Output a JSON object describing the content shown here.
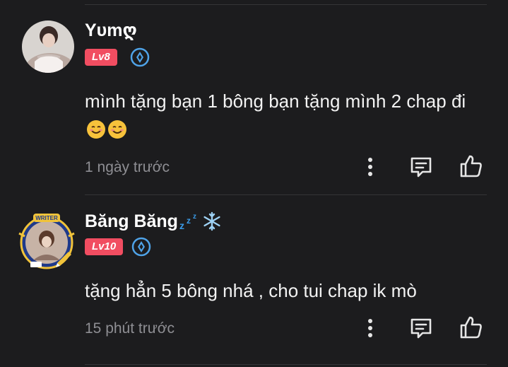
{
  "comments": [
    {
      "username": "Yυmღ",
      "level": "Lv8",
      "text": "mình tặng bạn 1 bông bạn tặng mình 2 chap đi",
      "emojis": [
        "smiling-face-emoji",
        "smiling-face-emoji"
      ],
      "time": "1 ngày trước"
    },
    {
      "username": "Băng Băng",
      "name_decorations": [
        "zzz-icon",
        "snowflake-icon"
      ],
      "level": "Lv10",
      "avatar_frame_text": "WRITER",
      "text": "tặng hẳn 5 bông nhá , cho tui chap ik mò",
      "time": "15 phút trước"
    }
  ],
  "colors": {
    "background": "#1c1c1e",
    "level_badge": "#f14d61",
    "medal_blue": "#4fa3e8",
    "text_muted": "#8e8e93"
  },
  "icons": {
    "more": "more-vertical-icon",
    "reply": "reply-comment-icon",
    "like": "thumbs-up-icon"
  }
}
